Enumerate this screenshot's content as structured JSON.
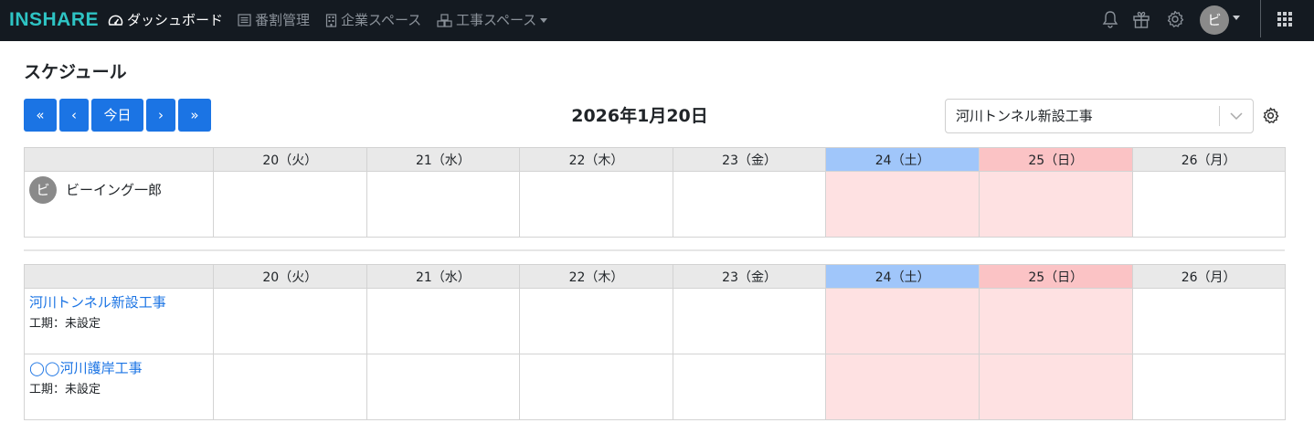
{
  "navbar": {
    "logo": "INSHARE",
    "items": [
      {
        "label": "ダッシュボード",
        "active": true
      },
      {
        "label": "番割管理"
      },
      {
        "label": "企業スペース"
      },
      {
        "label": "工事スペース"
      }
    ],
    "user_initial": "ビ"
  },
  "page": {
    "title": "スケジュール"
  },
  "toolbar": {
    "first_label": "«",
    "prev_label": "‹",
    "today_label": "今日",
    "next_label": "›",
    "last_label": "»",
    "date_title": "2026年1月20日",
    "project_select": "河川トンネル新設工事"
  },
  "days": [
    {
      "label": "20（火）"
    },
    {
      "label": "21（水）"
    },
    {
      "label": "22（木）"
    },
    {
      "label": "23（金）"
    },
    {
      "label": "24（土）",
      "type": "sat"
    },
    {
      "label": "25（日）",
      "type": "sun"
    },
    {
      "label": "26（月）"
    }
  ],
  "members": [
    {
      "initial": "ビ",
      "name": "ビーイング一郎"
    }
  ],
  "projects": [
    {
      "name": "河川トンネル新設工事",
      "period": "工期：未設定"
    },
    {
      "name": "◯◯河川護岸工事",
      "period": "工期：未設定"
    }
  ],
  "colors": {
    "navbar": "#141a21",
    "accent": "#1b74e4",
    "logo": "#2ec4c4",
    "saturday_header": "#a0c6fa",
    "sunday_header": "#fbc3c5",
    "weekend_cell": "#fee1e2"
  }
}
